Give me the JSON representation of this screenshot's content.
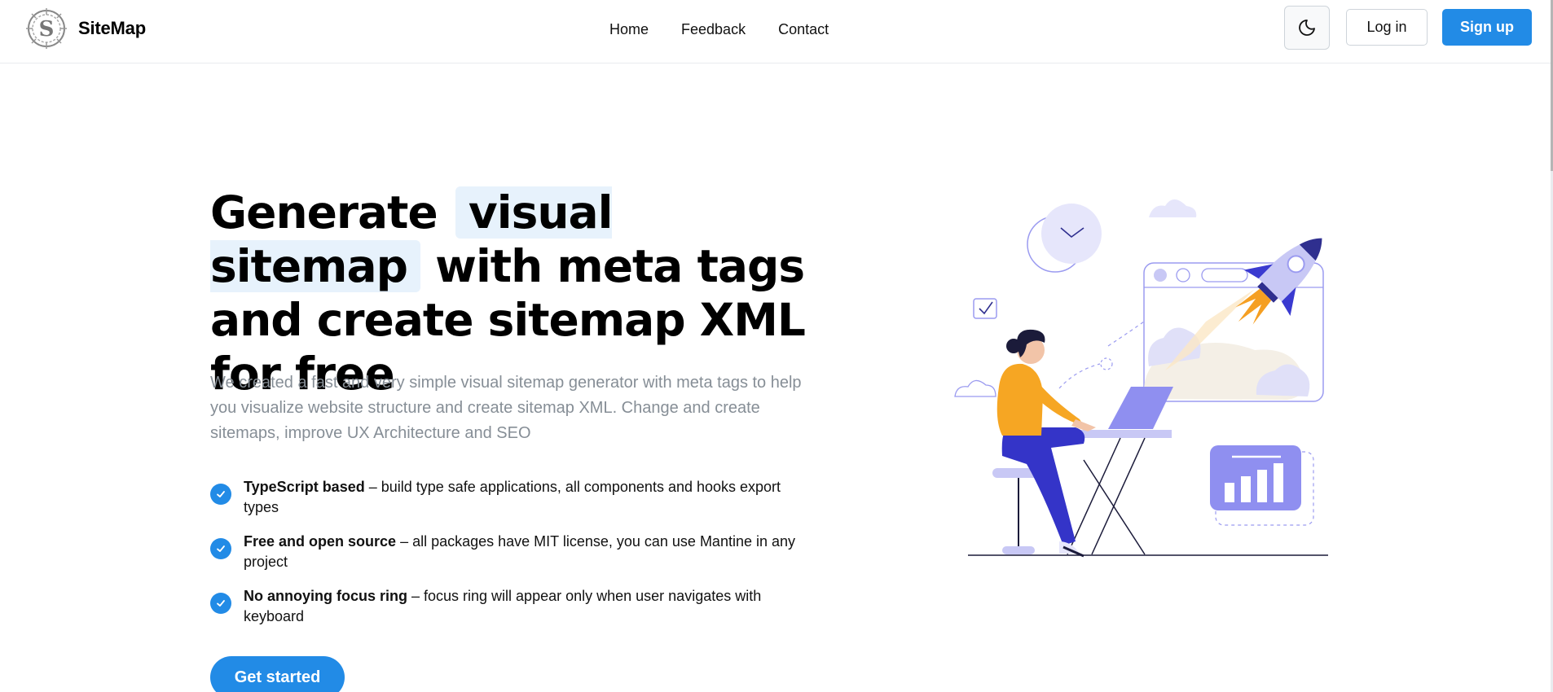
{
  "header": {
    "brand": "SiteMap",
    "nav": [
      "Home",
      "Feedback",
      "Contact"
    ],
    "login": "Log in",
    "signup": "Sign up"
  },
  "hero": {
    "title_part1": "Generate",
    "title_highlight": "visual sitemap",
    "title_part2": "with meta tags and create sitemap XML for free",
    "description": "We created a fast and very simple visual sitemap generator with meta tags to help you visualize website structure and create sitemap XML. Change and create sitemaps, improve UX Architecture and SEO",
    "features": [
      {
        "title": "TypeScript based",
        "text": " – build type safe applications, all components and hooks export types"
      },
      {
        "title": "Free and open source",
        "text": " – all packages have MIT license, you can use Mantine in any project"
      },
      {
        "title": "No annoying focus ring",
        "text": " – focus ring will appear only when user navigates with keyboard"
      }
    ],
    "cta": "Get started"
  },
  "colors": {
    "primary": "#228be6",
    "highlight": "#e7f2fc",
    "muted": "#868e96"
  },
  "icons": {
    "logo": "sitemap-logo-icon",
    "theme": "moon-icon",
    "check": "check-icon"
  }
}
